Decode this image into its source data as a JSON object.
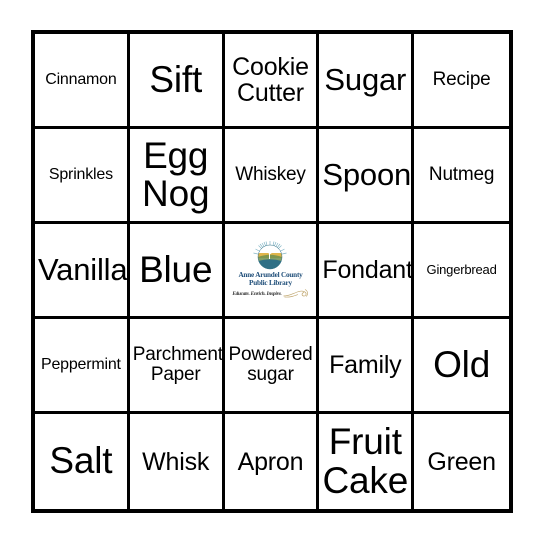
{
  "card": {
    "type": "bingo-card",
    "rows": 5,
    "columns": 5,
    "border_color": "#000000",
    "background_color": "#ffffff",
    "text_color": "#000000",
    "cells": [
      {
        "text": "Cinnamon",
        "size": "sm",
        "free": false
      },
      {
        "text": "Sift",
        "size": "xxl",
        "free": false
      },
      {
        "text": "Cookie Cutter",
        "size": "lg",
        "free": false
      },
      {
        "text": "Sugar",
        "size": "xl",
        "free": false
      },
      {
        "text": "Recipe",
        "size": "md",
        "free": false
      },
      {
        "text": "Sprinkles",
        "size": "sm",
        "free": false
      },
      {
        "text": "Egg Nog",
        "size": "xxl",
        "free": false
      },
      {
        "text": "Whiskey",
        "size": "md",
        "free": false
      },
      {
        "text": "Spoon",
        "size": "xl",
        "free": false
      },
      {
        "text": "Nutmeg",
        "size": "md",
        "free": false
      },
      {
        "text": "Vanilla",
        "size": "xl",
        "free": false
      },
      {
        "text": "Blue",
        "size": "xxl",
        "free": false
      },
      {
        "text": "",
        "size": "sm",
        "free": true
      },
      {
        "text": "Fondant",
        "size": "lg",
        "free": false
      },
      {
        "text": "Gingerbread",
        "size": "xs",
        "free": false
      },
      {
        "text": "Peppermint",
        "size": "sm",
        "free": false
      },
      {
        "text": "Parchment Paper",
        "size": "md",
        "free": false
      },
      {
        "text": "Powdered sugar",
        "size": "md",
        "free": false
      },
      {
        "text": "Family",
        "size": "lg",
        "free": false
      },
      {
        "text": "Old",
        "size": "xxl",
        "free": false
      },
      {
        "text": "Salt",
        "size": "xxl",
        "free": false
      },
      {
        "text": "Whisk",
        "size": "lg",
        "free": false
      },
      {
        "text": "Apron",
        "size": "lg",
        "free": false
      },
      {
        "text": "Fruit Cake",
        "size": "xxl",
        "free": false
      },
      {
        "text": "Green",
        "size": "lg",
        "free": false
      }
    ]
  },
  "logo": {
    "name_line_1": "Anne Arundel County",
    "name_line_2": "Public Library",
    "tagline": "Educate. Enrich. Inspire.",
    "text_color": "#1f4e79",
    "sun_color": "#e0b54a",
    "ray_color": "#7fb3c4",
    "water_color": "#2f6f85",
    "land_color": "#6d8f4e",
    "swirl_color": "#bfa46a"
  }
}
